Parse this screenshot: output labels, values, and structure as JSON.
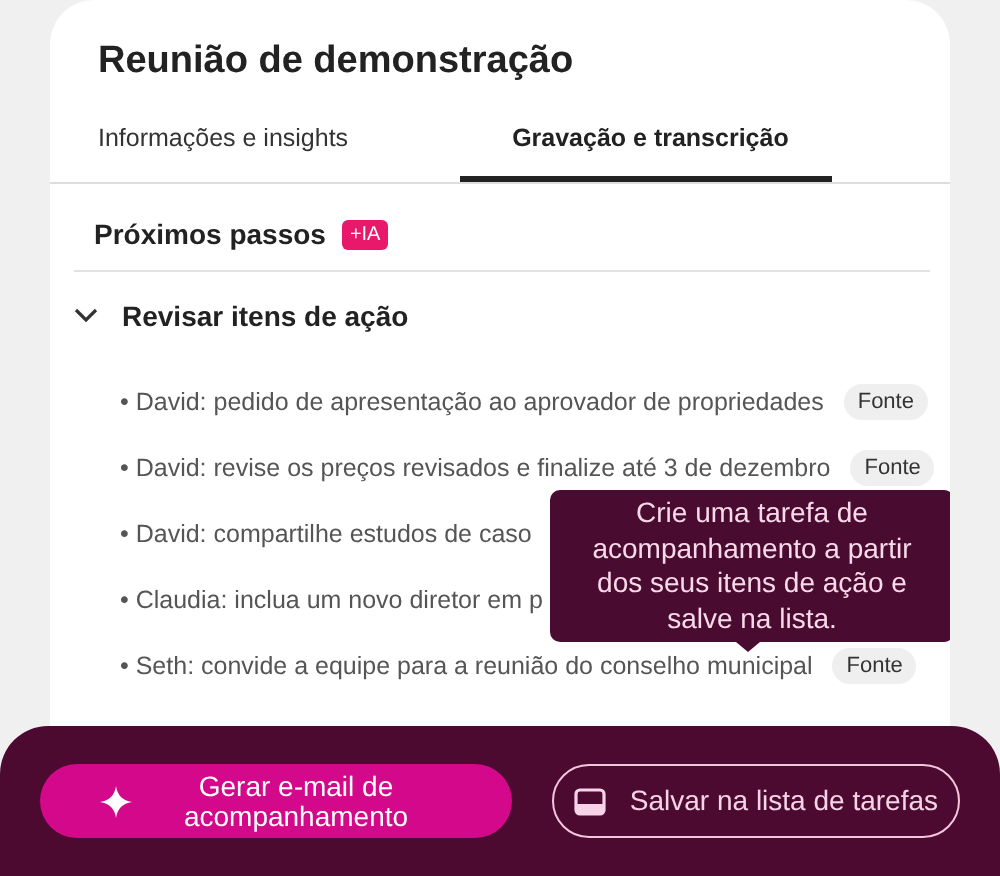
{
  "title": "Reunião de demonstração",
  "tabs": [
    {
      "label": "Informações e insights",
      "selected": false
    },
    {
      "label": "Gravação e transcrição",
      "selected": true
    }
  ],
  "section": {
    "title": "Próximos passos",
    "badge": "+IA"
  },
  "group": {
    "title": "Revisar itens de ação",
    "expanded": true
  },
  "items": [
    {
      "text": "• David: pedido de apresentação ao aprovador de propriedades",
      "source": "Fonte"
    },
    {
      "text": "• David: revise os preços revisados e finalize até 3 de dezembro",
      "source": "Fonte"
    },
    {
      "text": "• David: compartilhe estudos de caso"
    },
    {
      "text": "• Claudia: inclua um novo diretor em p"
    },
    {
      "text": "• Seth: convide a equipe para a reunião do conselho municipal",
      "source": "Fonte"
    }
  ],
  "tooltip": "Crie uma tarefa de acompanhamento a partir dos seus itens de ação e salve na lista.",
  "buttons": [
    {
      "kind": "primary",
      "label": "Gerar e-mail de acompanhamento"
    },
    {
      "kind": "outline",
      "label": "Salvar na lista de tarefas"
    }
  ]
}
